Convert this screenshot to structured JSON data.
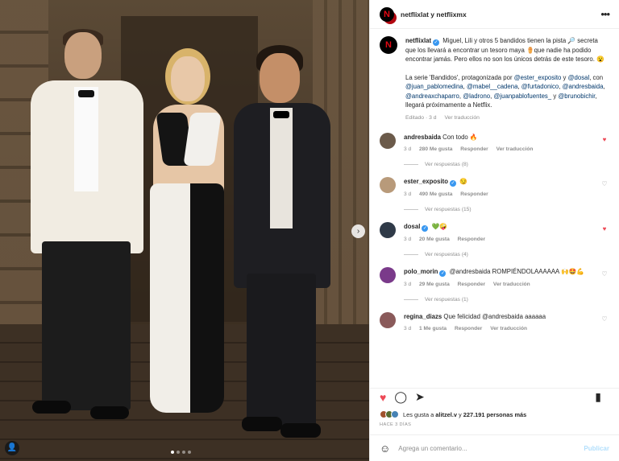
{
  "header": {
    "names": "netflixlat y netflixmx",
    "more_icon": "more-horizontal-icon"
  },
  "caption": {
    "username": "netflixlat",
    "text1": " Miguel, Lili y otros 5 bandidos tienen la pista 🔎 secreta que los llevará a encontrar un tesoro maya ⚱️que nadie ha podido encontrar jamás. Pero ellos no son los únicos detrás de este tesoro. 😮",
    "text2_prefix": "La serie 'Bandidos', protagonizada por ",
    "mentions": [
      "@ester_exposito",
      "@dosal",
      "@juan_pablomedina",
      "@mabel__cadena",
      "@furtadonico",
      "@andresbaida",
      "@andreaxchaparro",
      "@ladrono",
      "@juanpablofuentes_",
      "@brunobichir"
    ],
    "text2_suffix": ", llegará próximamente a Netflix.",
    "meta_edited": "Editado · 3 d",
    "meta_translate": "Ver traducción"
  },
  "comments": [
    {
      "user": "andresbaida",
      "verified": false,
      "text": " Con todo 🔥",
      "age": "3 d",
      "likes": "280 Me gusta",
      "reply": "Responder",
      "translate": "Ver traducción",
      "liked": true,
      "replies": "Ver respuestas (8)",
      "avatar_color": "#6b5a4a"
    },
    {
      "user": "ester_exposito",
      "verified": true,
      "text": " 😏",
      "age": "3 d",
      "likes": "490 Me gusta",
      "reply": "Responder",
      "translate": "",
      "liked": false,
      "replies": "Ver respuestas (15)",
      "avatar_color": "#b89a7a"
    },
    {
      "user": "dosal",
      "verified": true,
      "text": " 💚🤪",
      "age": "3 d",
      "likes": "20 Me gusta",
      "reply": "Responder",
      "translate": "",
      "liked": true,
      "replies": "Ver respuestas (4)",
      "avatar_color": "#2f3a48"
    },
    {
      "user": "polo_morin",
      "verified": true,
      "text": " @andresbaida ROMPIÉNDOLAAAAAA 🙌🤩💪",
      "age": "3 d",
      "likes": "29 Me gusta",
      "reply": "Responder",
      "translate": "Ver traducción",
      "liked": false,
      "replies": "Ver respuestas (1)",
      "avatar_color": "#7a3a8a"
    },
    {
      "user": "regina_diazs",
      "verified": false,
      "text": " Que felicidad @andresbaida aaaaaa",
      "age": "3 d",
      "likes": "1 Me gusta",
      "reply": "Responder",
      "translate": "Ver traducción",
      "liked": false,
      "replies": "",
      "avatar_color": "#8a5a5a"
    }
  ],
  "actions": {
    "like_icon": "heart-filled-icon",
    "comment_icon": "comment-icon",
    "share_icon": "share-icon",
    "save_icon": "bookmark-filled-icon"
  },
  "likes": {
    "text_prefix": "Les gusta a ",
    "user": "alitzel.v",
    "text_mid": " y ",
    "count": "227.191 personas más"
  },
  "ago": "HACE 3 DÍAS",
  "composer": {
    "placeholder": "Agrega un comentario...",
    "post_label": "Publicar",
    "emoji_icon": "smiley-icon"
  },
  "colors": {
    "netflix_red": "#e50914",
    "like_red": "#ed4956",
    "link_blue": "#00376b",
    "verified_blue": "#3897f0"
  }
}
